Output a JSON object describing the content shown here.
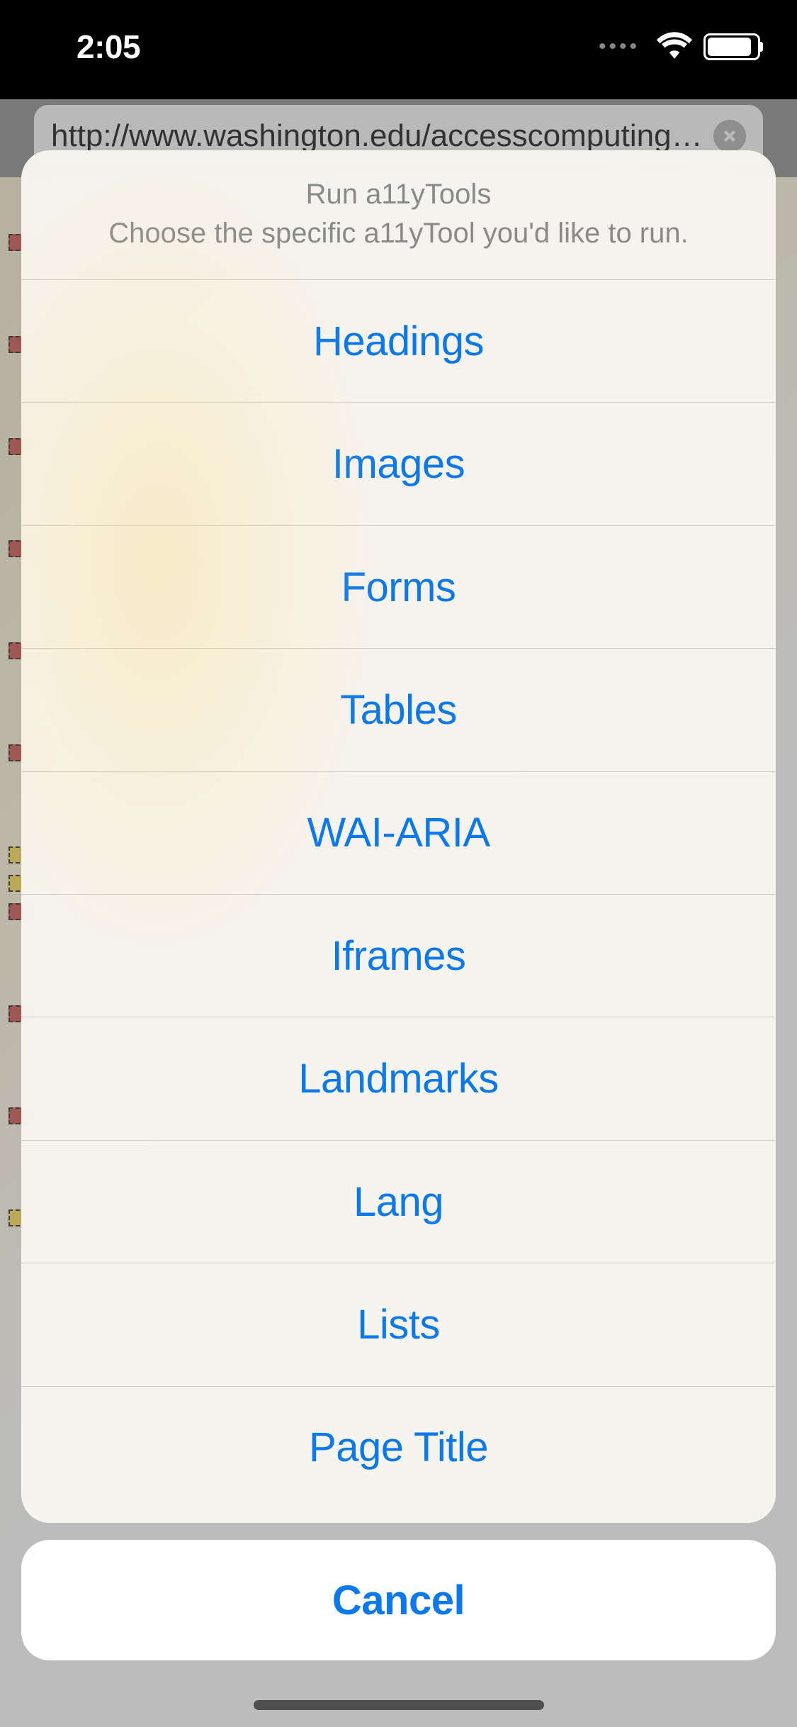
{
  "status_bar": {
    "time": "2:05"
  },
  "url_bar": {
    "url": "http://www.washington.edu/accesscomputing/A..."
  },
  "action_sheet": {
    "title": "Run a11yTools",
    "subtitle": "Choose the specific a11yTool you'd like to run.",
    "options": [
      "Headings",
      "Images",
      "Forms",
      "Tables",
      "WAI-ARIA",
      "Iframes",
      "Landmarks",
      "Lang",
      "Lists",
      "Page Title"
    ],
    "cancel": "Cancel"
  }
}
